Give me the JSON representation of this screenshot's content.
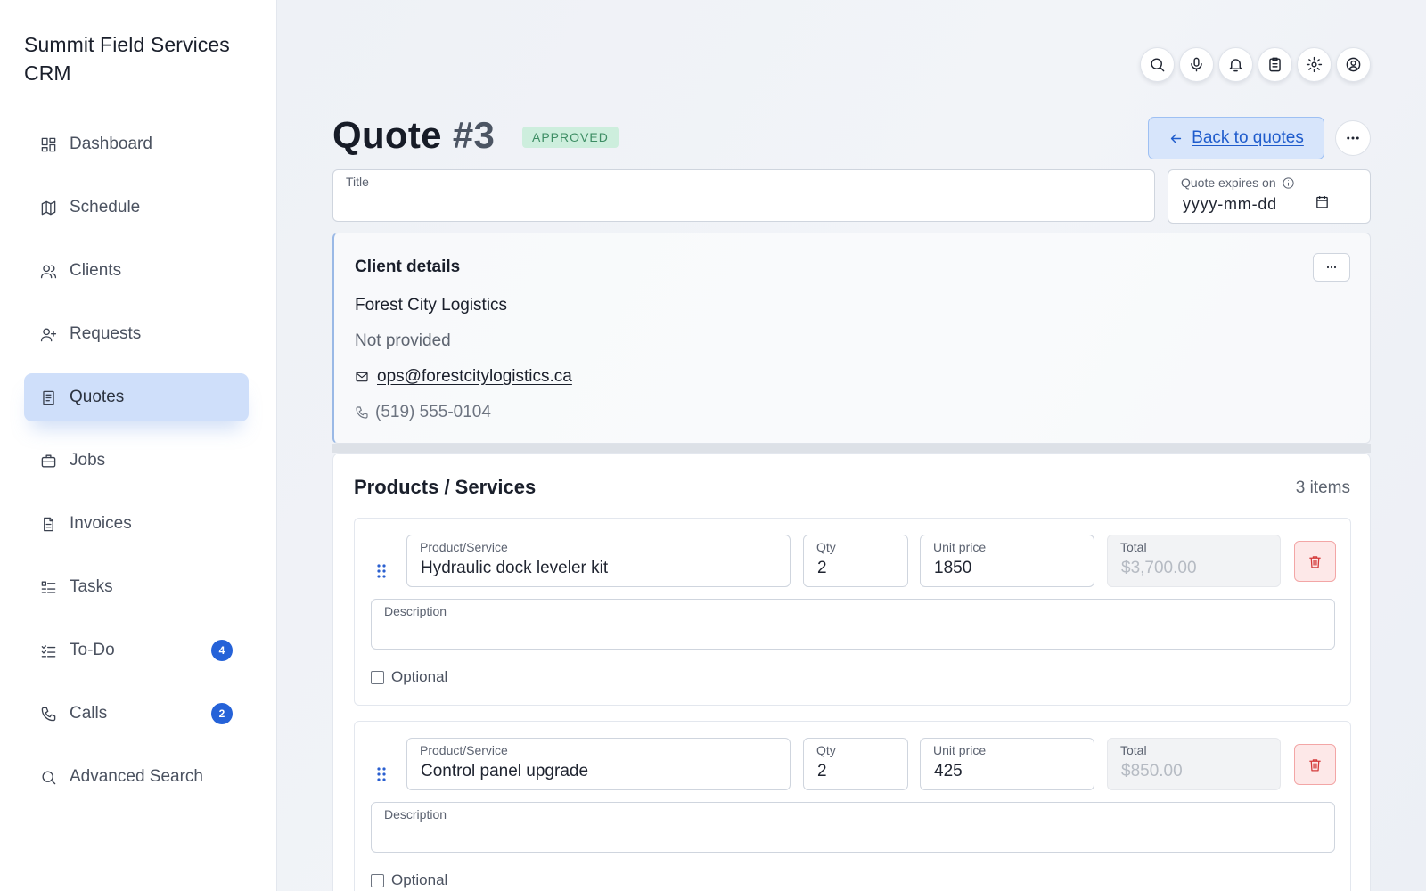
{
  "app": {
    "title": "Summit Field Services CRM"
  },
  "sidebar": {
    "items": [
      {
        "label": "Dashboard",
        "icon": "dashboard-icon"
      },
      {
        "label": "Schedule",
        "icon": "map-icon"
      },
      {
        "label": "Clients",
        "icon": "users-icon"
      },
      {
        "label": "Requests",
        "icon": "user-plus-icon"
      },
      {
        "label": "Quotes",
        "icon": "document-icon",
        "active": true
      },
      {
        "label": "Jobs",
        "icon": "briefcase-icon"
      },
      {
        "label": "Invoices",
        "icon": "file-icon"
      },
      {
        "label": "Tasks",
        "icon": "list-icon"
      },
      {
        "label": "To-Do",
        "icon": "checklist-icon",
        "badge": "4"
      },
      {
        "label": "Calls",
        "icon": "phone-icon",
        "badge": "2"
      },
      {
        "label": "Advanced Search",
        "icon": "search-icon"
      }
    ]
  },
  "topbar": {
    "icons": [
      "search-icon",
      "microphone-icon",
      "bell-icon",
      "clipboard-icon",
      "gear-icon",
      "user-circle-icon"
    ]
  },
  "header": {
    "title_prefix": "Quote",
    "title_number": "#3",
    "status": "APPROVED",
    "back_label": "Back to quotes"
  },
  "form": {
    "title_label": "Title",
    "title_value": "",
    "expires_label": "Quote expires on",
    "expires_value": "yyyy-mm-dd"
  },
  "client": {
    "section_title": "Client details",
    "name": "Forest City Logistics",
    "address": "Not provided",
    "email": "ops@forestcitylogistics.ca",
    "phone": "(519) 555-0104"
  },
  "products": {
    "section_title": "Products / Services",
    "count": "3 items",
    "labels": {
      "product": "Product/Service",
      "qty": "Qty",
      "unit_price": "Unit price",
      "total": "Total",
      "description": "Description",
      "optional": "Optional"
    },
    "items": [
      {
        "product": "Hydraulic dock leveler kit",
        "qty": "2",
        "unit_price": "1850",
        "total": "$3,700.00",
        "description": ""
      },
      {
        "product": "Control panel upgrade",
        "qty": "2",
        "unit_price": "425",
        "total": "$850.00",
        "description": ""
      }
    ]
  },
  "colors": {
    "accent": "#2562d8",
    "active_nav": "#cfdffa",
    "status_bg": "#cdeedd",
    "status_text": "#3d8d64",
    "danger": "#d43a3a"
  }
}
